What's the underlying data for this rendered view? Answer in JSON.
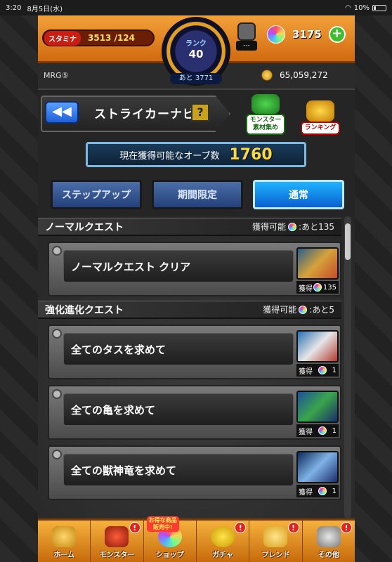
{
  "status_bar": {
    "time": "3:20",
    "date": "8月5日(水)",
    "battery": "10%"
  },
  "hud": {
    "stamina_label": "スタミナ",
    "stamina_value": "3513 /124",
    "rank_label": "ランク",
    "rank_value": "40",
    "exp_remaining": "あと 3771",
    "gear_value": "---",
    "orb_count": "3175",
    "add_label": "+",
    "player_name": "MRG⑤",
    "gold": "65,059,272"
  },
  "header": {
    "back_label": "◀◀",
    "title": "ストライカーナビ",
    "help_label": "?",
    "monster_button": "モンスター\n素材集め",
    "ranking_button": "ランキング"
  },
  "banner": {
    "label": "現在獲得可能なオーブ数",
    "value": "1760"
  },
  "tabs": [
    {
      "label": "ステップアップ",
      "active": false
    },
    {
      "label": "期間限定",
      "active": false
    },
    {
      "label": "通常",
      "active": true
    }
  ],
  "sections": [
    {
      "title": "ノーマルクエスト",
      "avail_prefix": "獲得可能",
      "avail_suffix": ":あと135",
      "quests": [
        {
          "name": "ノーマルクエスト クリア",
          "reward_prefix": "獲得",
          "reward_value": "135",
          "thumb": "t1"
        }
      ]
    },
    {
      "title": "強化進化クエスト",
      "avail_prefix": "獲得可能",
      "avail_suffix": ":あと5",
      "quests": [
        {
          "name": "全てのタスを求めて",
          "reward_prefix": "獲得",
          "reward_value": "1",
          "thumb": "t2"
        },
        {
          "name": "全ての亀を求めて",
          "reward_prefix": "獲得",
          "reward_value": "1",
          "thumb": "t3"
        },
        {
          "name": "全ての獣神竜を求めて",
          "reward_prefix": "獲得",
          "reward_value": "1",
          "thumb": "t4"
        }
      ]
    }
  ],
  "nav": [
    {
      "label": "ホーム",
      "icon": "home-icon",
      "badge": ""
    },
    {
      "label": "モンスター",
      "icon": "monster-icon",
      "badge": "!"
    },
    {
      "label": "ショップ",
      "icon": "shop-icon",
      "badge": "",
      "promo": "お得な商品\n販売中!"
    },
    {
      "label": "ガチャ",
      "icon": "gacha-icon",
      "badge": "!"
    },
    {
      "label": "フレンド",
      "icon": "friend-icon",
      "badge": "!"
    },
    {
      "label": "その他",
      "icon": "other-icon",
      "badge": "!"
    }
  ]
}
